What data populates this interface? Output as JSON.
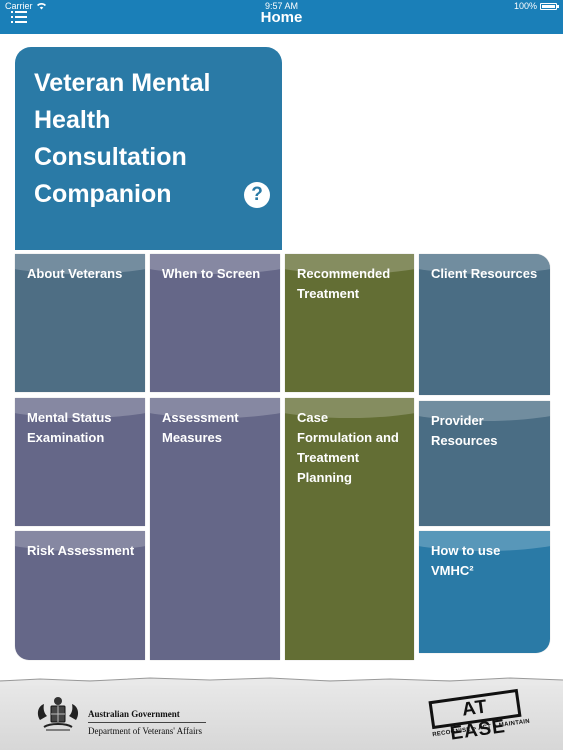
{
  "status_bar": {
    "carrier": "Carrier",
    "time": "9:57 AM",
    "battery": "100%"
  },
  "nav": {
    "title": "Home",
    "menu_icon": "hamburger-menu-icon"
  },
  "app_panel": {
    "title_lines": [
      "Veteran Mental",
      "Health",
      "Consultation",
      "Companion"
    ],
    "help_label": "?"
  },
  "tiles": {
    "about_veterans": "About Veterans",
    "when_to_screen": "When to Screen",
    "recommended_treatment": "Recommended Treatment",
    "client_resources": "Client Resources",
    "mental_status_examination": "Mental Status Examination",
    "assessment_measures": "Assessment Measures",
    "case_formulation": "Case Formulation and Treatment Planning",
    "provider_resources": "Provider Resources",
    "risk_assessment": "Risk Assessment",
    "how_to_use": "How to use VMHC²"
  },
  "footer": {
    "gov_line1": "Australian Government",
    "gov_line2": "Department of Veterans' Affairs",
    "logo_text": "AT EASE",
    "logo_tagline": "RECOGNISE > ACT > MAINTAIN"
  },
  "colors": {
    "brand_blue": "#2a7aa6",
    "status_bar": "#1a7fb8",
    "slate": "#4e6e84",
    "purple": "#656788",
    "olive": "#636e34"
  }
}
